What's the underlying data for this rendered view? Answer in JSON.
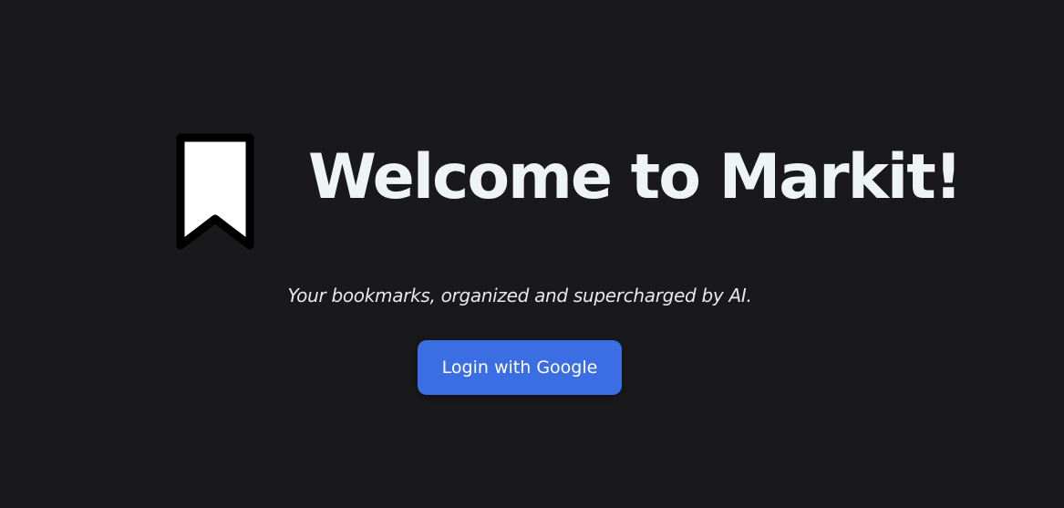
{
  "app": {
    "logo_icon": "bookmark-icon",
    "title": "Welcome to Markit!",
    "tagline": "Your bookmarks, organized and supercharged by AI.",
    "login_label": "Login with Google"
  },
  "colors": {
    "background": "#19191b",
    "accent": "#3b6ee3",
    "title": "#eef3f6"
  }
}
